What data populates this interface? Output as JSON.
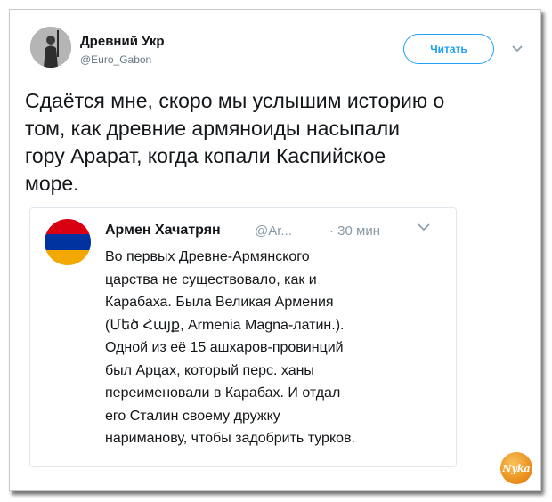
{
  "tweet": {
    "author_name": "Древний Укр",
    "author_handle": "@Euro_Gabon",
    "follow_label": "Читать",
    "text_lines": [
      "Сдаётся мне, скоро мы услышим историю о",
      "том, как древние армяноиды насыпали",
      "гору Арарат, когда копали Каспийское",
      "море."
    ]
  },
  "quoted_tweet": {
    "author_name": "Армен Хачатрян",
    "author_handle": "@Ar...",
    "time": "· 30 мин",
    "text_lines": [
      "Во первых Древне-Армянского",
      "царства не существовало, как и",
      "Карабаха. Была Великая Армения",
      "(Մեծ Հայք, Armenia Magna-латин.).",
      "Одной из её 15 ашхаров-провинций",
      "был Арцах, который перс. ханы",
      "переименовали в Карабах. И отдал",
      "его Сталин своему дружку",
      "нариманову, чтобы задобрить турков."
    ],
    "flag_colors": [
      "#d90012",
      "#0033a0",
      "#f2a800"
    ]
  },
  "watermark": {
    "text": "Nyka"
  },
  "colors": {
    "accent": "#1da1f2",
    "secondary_text": "#657786"
  }
}
